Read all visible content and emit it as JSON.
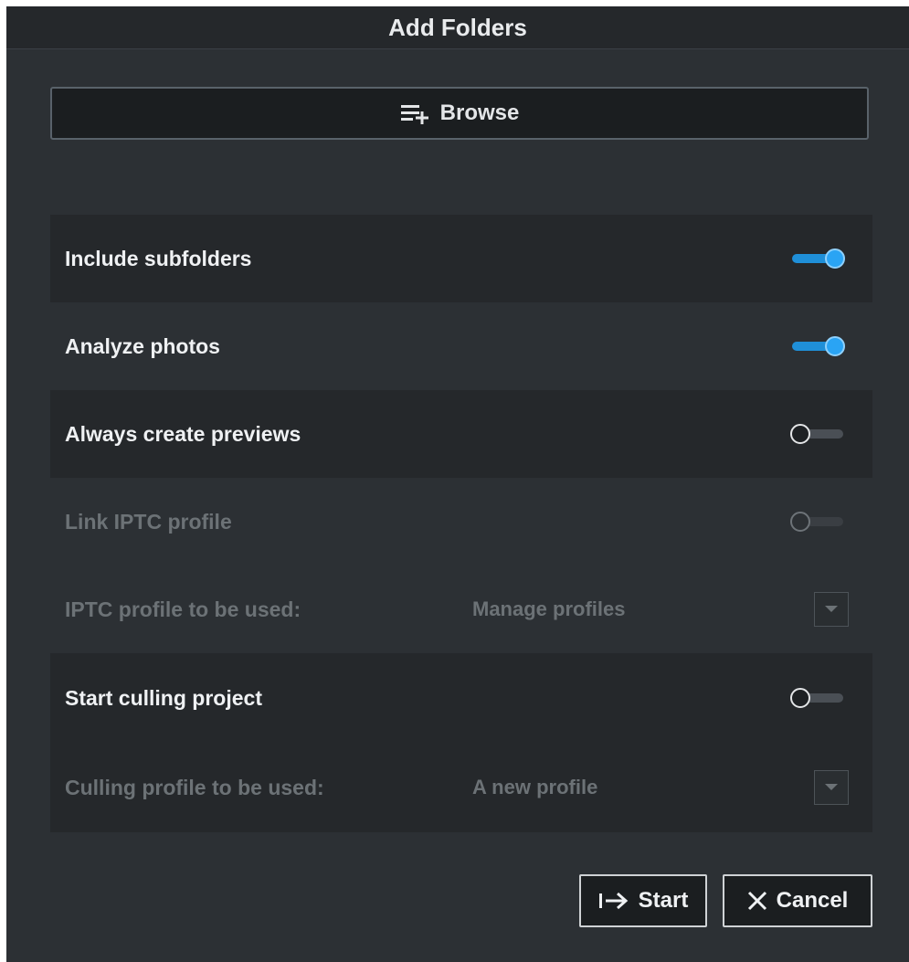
{
  "dialog": {
    "title": "Add Folders"
  },
  "browse": {
    "label": "Browse",
    "icon": "playlist-add-icon"
  },
  "options": {
    "include_subfolders": {
      "label": "Include subfolders",
      "enabled": true,
      "state": "on"
    },
    "analyze_photos": {
      "label": "Analyze photos",
      "enabled": true,
      "state": "on"
    },
    "always_create_previews": {
      "label": "Always create previews",
      "enabled": true,
      "state": "off"
    },
    "link_iptc_profile": {
      "label": "Link IPTC profile",
      "enabled": false,
      "state": "off"
    },
    "iptc_profile": {
      "label": "IPTC profile to be used:",
      "value": "Manage profiles",
      "enabled": false
    },
    "start_culling_project": {
      "label": "Start culling project",
      "enabled": true,
      "state": "off"
    },
    "culling_profile": {
      "label": "Culling profile to be used:",
      "value": "A new profile",
      "enabled": false
    }
  },
  "footer": {
    "start_label": "Start",
    "cancel_label": "Cancel"
  },
  "colors": {
    "accent": "#2aa4f4",
    "background": "#2c3034",
    "row_shade": "#25282b",
    "disabled_text": "#6c7276"
  }
}
